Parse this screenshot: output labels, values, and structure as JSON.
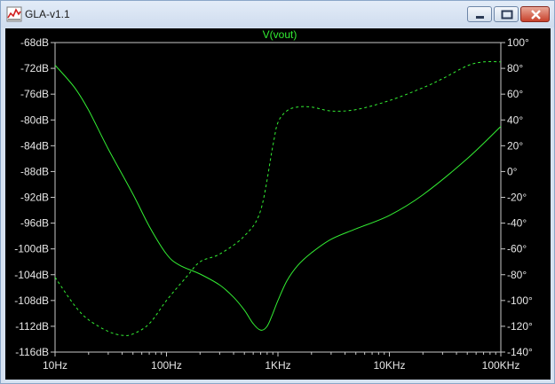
{
  "window": {
    "title": "GLA-v1.1",
    "app_icon": "waveform-chart-icon",
    "controls": [
      "minimize-icon",
      "maximize-icon",
      "close-icon"
    ]
  },
  "colors": {
    "plot_background": "#000000",
    "trace": "#33ee33",
    "axis": "#c8c8c8",
    "label": "#e6e6e6"
  },
  "chart_data": {
    "type": "line",
    "title": "V(vout)",
    "x_scale": "log",
    "xlim": [
      10,
      100000
    ],
    "x_ticks": [
      10,
      100,
      1000,
      10000,
      100000
    ],
    "x_tick_labels": [
      "10Hz",
      "100Hz",
      "1KHz",
      "10KHz",
      "100KHz"
    ],
    "ylim_left": [
      -116,
      -68
    ],
    "y_left_ticks": [
      -68,
      -72,
      -76,
      -80,
      -84,
      -88,
      -92,
      -96,
      -100,
      -104,
      -108,
      -112,
      -116
    ],
    "y_left_tick_labels": [
      "-68dB",
      "-72dB",
      "-76dB",
      "-80dB",
      "-84dB",
      "-88dB",
      "-92dB",
      "-96dB",
      "-100dB",
      "-104dB",
      "-108dB",
      "-112dB",
      "-116dB"
    ],
    "ylim_right": [
      -140,
      100
    ],
    "y_right_ticks": [
      100,
      80,
      60,
      40,
      20,
      0,
      -20,
      -40,
      -60,
      -80,
      -100,
      -120,
      -140
    ],
    "y_right_tick_labels": [
      "100°",
      "80°",
      "60°",
      "40°",
      "20°",
      "0°",
      "-20°",
      "-40°",
      "-60°",
      "-80°",
      "-100°",
      "-120°",
      "-140°"
    ],
    "grid": false,
    "series": [
      {
        "style": "solid",
        "axis": "left",
        "x": [
          10,
          15,
          20,
          30,
          50,
          70,
          100,
          130,
          200,
          300,
          400,
          500,
          600,
          700,
          800,
          900,
          1000,
          1200,
          1500,
          2000,
          3000,
          5000,
          10000,
          20000,
          50000,
          100000
        ],
        "y": [
          -71.5,
          -75,
          -78.5,
          -84.5,
          -91.5,
          -96.5,
          -100.8,
          -102.5,
          -103.9,
          -105.6,
          -107.5,
          -109.5,
          -111.6,
          -112.6,
          -112.0,
          -110.0,
          -108.0,
          -105.0,
          -102.6,
          -100.6,
          -98.5,
          -96.9,
          -94.8,
          -91.6,
          -86.0,
          -81.0
        ]
      },
      {
        "style": "dashed",
        "axis": "right",
        "x": [
          10,
          15,
          20,
          30,
          40,
          50,
          70,
          100,
          150,
          200,
          300,
          500,
          700,
          900,
          1000,
          1200,
          1500,
          2000,
          3000,
          5000,
          10000,
          20000,
          30000,
          50000,
          70000,
          100000
        ],
        "y": [
          -82,
          -104,
          -115,
          -124,
          -127,
          -126,
          -118,
          -100,
          -82,
          -70,
          -64,
          -50,
          -30,
          20,
          38,
          47,
          50,
          50,
          47,
          48,
          55,
          65,
          72,
          82,
          85,
          85
        ]
      }
    ]
  }
}
